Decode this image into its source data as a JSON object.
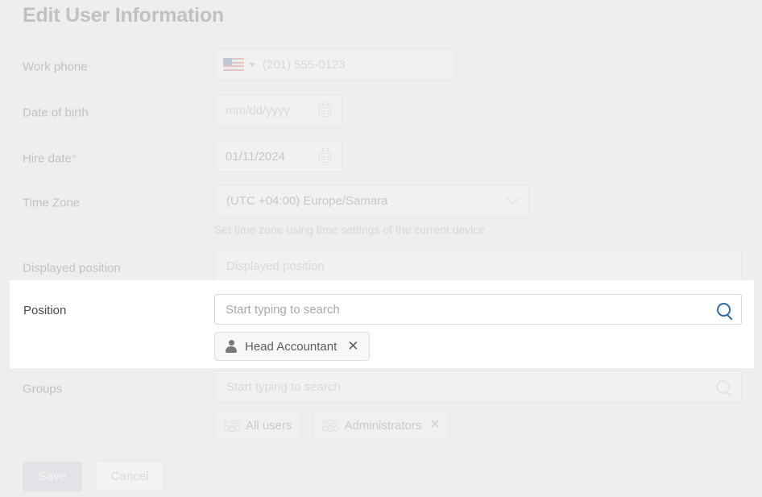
{
  "page": {
    "title": "Edit User Information"
  },
  "fields": {
    "work_phone": {
      "label": "Work phone",
      "country_flag": "us-flag-icon",
      "placeholder": "(201) 555-0123",
      "value": ""
    },
    "date_of_birth": {
      "label": "Date of birth",
      "placeholder": "mm/dd/yyyy",
      "value": "",
      "icon": "calendar-icon"
    },
    "hire_date": {
      "label": "Hire date",
      "required_marker": "*",
      "value": "01/11/2024",
      "icon": "calendar-icon"
    },
    "time_zone": {
      "label": "Time Zone",
      "value": "(UTC +04:00) Europe/Samara",
      "hint": "Set time zone using time settings of the current device",
      "icon": "chevron-down-icon"
    },
    "displayed_position": {
      "label": "Displayed position",
      "placeholder": "Displayed position",
      "value": ""
    },
    "position": {
      "label": "Position",
      "placeholder": "Start typing to search",
      "value": "",
      "icon": "search-icon",
      "chips": [
        {
          "label": "Head Accountant",
          "icon": "person-icon",
          "removable": true,
          "remove_label": "✕"
        }
      ]
    },
    "groups": {
      "label": "Groups",
      "placeholder": "Start typing to search",
      "value": "",
      "icon": "search-icon",
      "chips": [
        {
          "label": "All users",
          "icon": "people-icon",
          "removable": false,
          "remove_label": ""
        },
        {
          "label": "Administrators",
          "icon": "people-icon",
          "removable": true,
          "remove_label": "✕"
        }
      ]
    }
  },
  "actions": {
    "save_label": "Save",
    "cancel_label": "Cancel"
  },
  "colors": {
    "background": "#eeeeee",
    "accent_search": "#2b6ca3",
    "required_star": "#e8736f",
    "save_button": "#c5cbd6",
    "hint_text": "#9fa6b4"
  }
}
